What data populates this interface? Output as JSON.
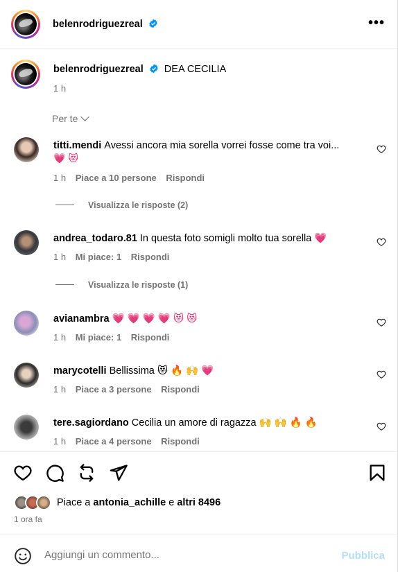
{
  "header": {
    "username": "belenrodriguezreal",
    "more": "•••"
  },
  "caption": {
    "username": "belenrodriguezreal",
    "text": "DEA CECILIA",
    "time": "1 h"
  },
  "sort": {
    "label": "Per te"
  },
  "comments": [
    {
      "username": "titti.mendi",
      "text": "Avessi ancora mia sorella vorrei fosse come tra voi...",
      "emoji_line": "💗 😻",
      "time": "1 h",
      "likes": "Piace a 10 persone",
      "reply": "Rispondi",
      "view_replies": "Visualizza le risposte (2)"
    },
    {
      "username": "andrea_todaro.81",
      "text": "In questa foto somigli molto tua sorella 💗",
      "time": "1 h",
      "likes": "Mi piace: 1",
      "reply": "Rispondi",
      "view_replies": "Visualizza le risposte (1)"
    },
    {
      "username": "avianambra",
      "text": "💗 💗 💗 💗 😻 😻",
      "time": "1 h",
      "likes": "Mi piace: 1",
      "reply": "Rispondi"
    },
    {
      "username": "marycotelli",
      "text": "Bellissima 😻 🔥 🙌 💗",
      "time": "1 h",
      "likes": "Piace a 3 persone",
      "reply": "Rispondi"
    },
    {
      "username": "tere.sagiordano",
      "text": "Cecilia un amore di ragazza 🙌 🙌 🔥 🔥",
      "time": "1 h",
      "likes": "Piace a 4 persone",
      "reply": "Rispondi"
    }
  ],
  "likes_summary": {
    "prefix": "Piace a",
    "user": "antonia_achille",
    "middle": "e",
    "others": "altri 8496"
  },
  "post_time": "1 ora fa",
  "add_comment": {
    "placeholder": "Aggiungi un commento...",
    "publish": "Pubblica"
  },
  "colors": {
    "muted": "#737373",
    "verified": "#0095f6",
    "publish_disabled": "#b2dffc"
  }
}
